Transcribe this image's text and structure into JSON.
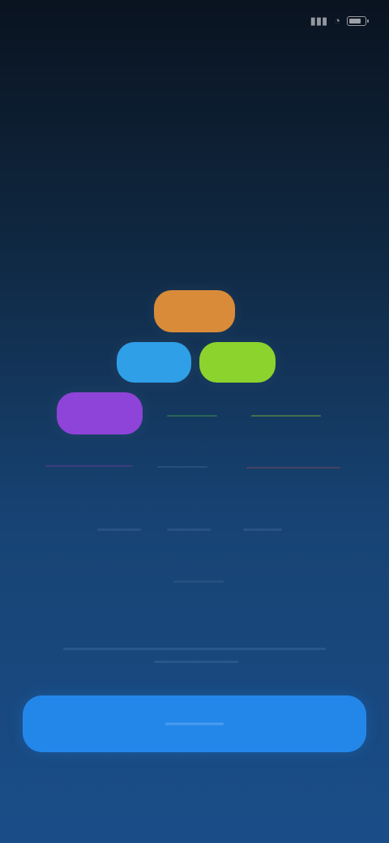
{
  "status_bar": {
    "time": "",
    "icons": [
      "signal-icon",
      "wifi-icon",
      "battery-icon"
    ]
  },
  "hero": {
    "headline_line_1": "",
    "headline_line_2": "",
    "subtitle": ""
  },
  "diagram": {
    "nodes": [
      {
        "name": "orange-node",
        "color": "#d98b3a"
      },
      {
        "name": "blue-node",
        "color": "#2f9fe7"
      },
      {
        "name": "green-node",
        "color": "#8cd32e"
      },
      {
        "name": "purple-node",
        "color": "#8e44d8"
      }
    ]
  },
  "cta": {
    "label": ""
  },
  "colors": {
    "background_top": "#0a1320",
    "background_bottom": "#1a4d88",
    "cta": "#2387ea"
  }
}
